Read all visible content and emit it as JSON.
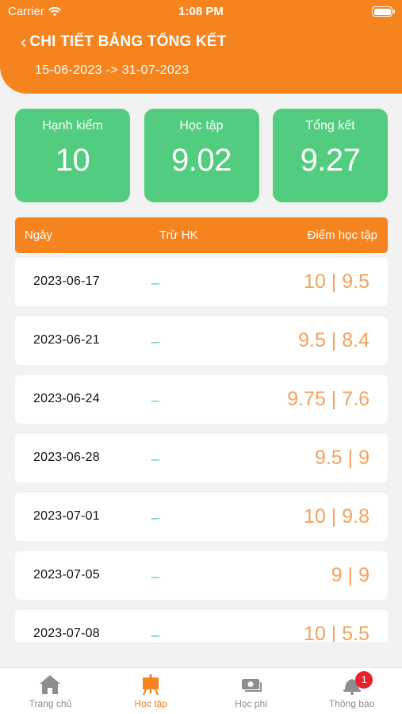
{
  "status_bar": {
    "carrier": "Carrier",
    "time": "1:08 PM"
  },
  "header": {
    "title": "CHI TIẾT BẢNG TỔNG KẾT",
    "date_range": "15-06-2023 -> 31-07-2023"
  },
  "summary": [
    {
      "label": "Hạnh kiểm",
      "value": "10"
    },
    {
      "label": "Học tập",
      "value": "9.02"
    },
    {
      "label": "Tổng kết",
      "value": "9.27"
    }
  ],
  "table": {
    "headers": {
      "date": "Ngày",
      "deduct": "Trừ HK",
      "score": "Điểm học tập"
    },
    "rows": [
      {
        "date": "2023-06-17",
        "deduct": "_",
        "score": "10 | 9.5"
      },
      {
        "date": "2023-06-21",
        "deduct": "_",
        "score": "9.5 | 8.4"
      },
      {
        "date": "2023-06-24",
        "deduct": "_",
        "score": "9.75 | 7.6"
      },
      {
        "date": "2023-06-28",
        "deduct": "_",
        "score": "9.5 | 9"
      },
      {
        "date": "2023-07-01",
        "deduct": "_",
        "score": "10 | 9.8"
      },
      {
        "date": "2023-07-05",
        "deduct": "_",
        "score": "9 | 9"
      },
      {
        "date": "2023-07-08",
        "deduct": "_",
        "score": "10 | 5.5"
      }
    ]
  },
  "tabbar": {
    "home": "Trang chủ",
    "study": "Học tập",
    "fees": "Học phí",
    "notifications": "Thông báo",
    "notification_badge": "1"
  },
  "colors": {
    "accent": "#f5841f",
    "card_green": "#52cc7e",
    "score_text": "#f5a25a",
    "badge": "#e8232b"
  }
}
